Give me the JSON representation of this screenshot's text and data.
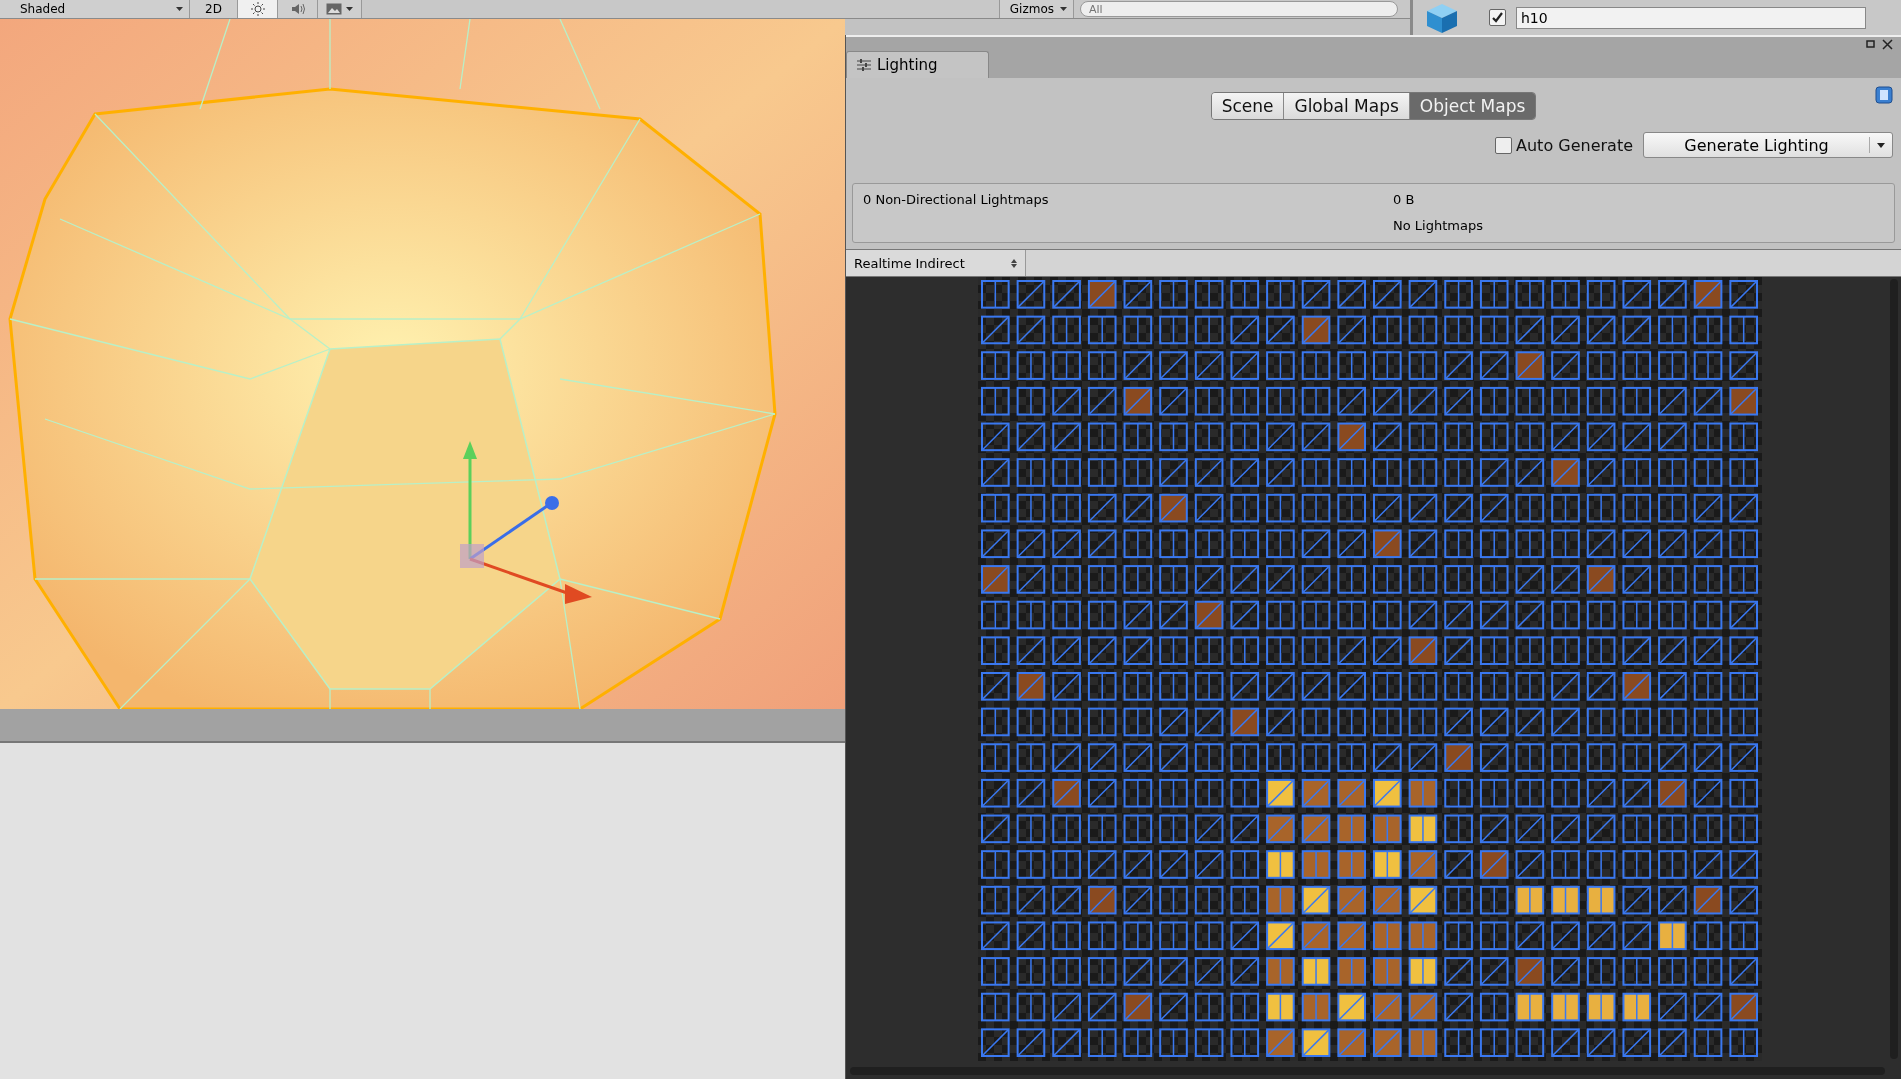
{
  "scene_toolbar": {
    "shading_mode": "Shaded",
    "mode_2d": "2D",
    "gizmos": "Gizmos",
    "search": {
      "placeholder": "All"
    }
  },
  "inspector": {
    "active": true,
    "name": "h10"
  },
  "lighting_window": {
    "title": "Lighting",
    "tabs": [
      {
        "label": "Scene",
        "selected": false
      },
      {
        "label": "Global Maps",
        "selected": false
      },
      {
        "label": "Object Maps",
        "selected": true
      }
    ],
    "auto_generate": {
      "label": "Auto Generate",
      "checked": false
    },
    "generate_button": "Generate Lighting",
    "stats": {
      "label": "0 Non-Directional Lightmaps",
      "size": "0 B",
      "note": "No Lightmaps"
    },
    "view_mode": "Realtime Indirect"
  }
}
